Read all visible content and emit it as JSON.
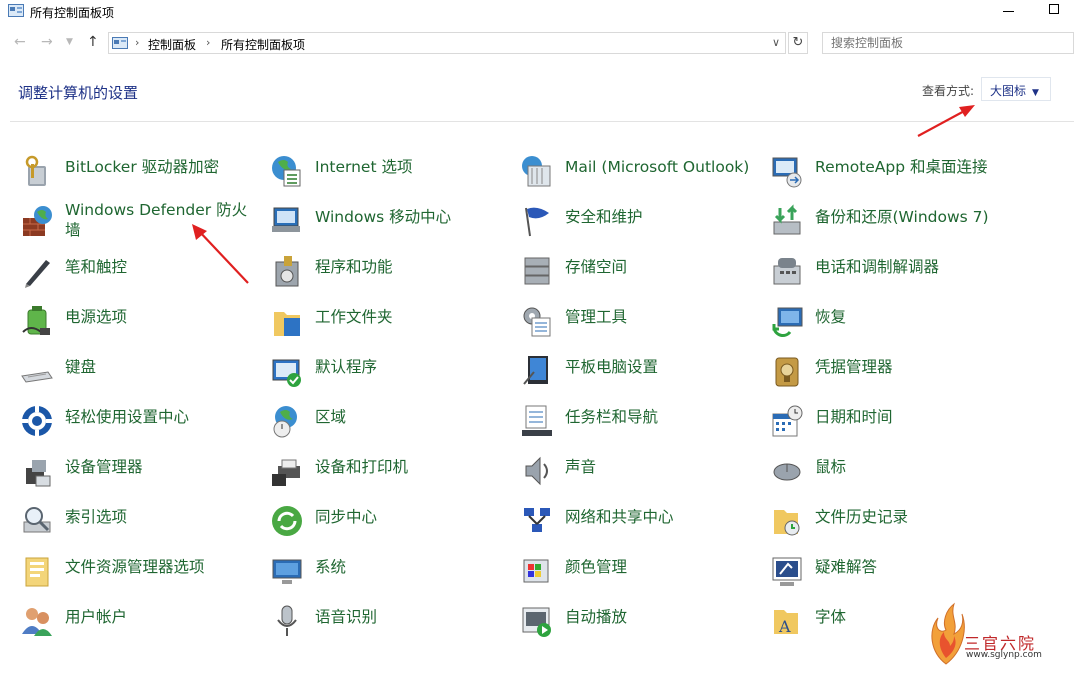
{
  "window": {
    "title": "所有控制面板项",
    "app_icon": "control-panel-icon"
  },
  "address": {
    "breadcrumbs": [
      "控制面板",
      "所有控制面板项"
    ],
    "search_placeholder": "搜索控制面板"
  },
  "header": {
    "title": "调整计算机的设置",
    "view_label": "查看方式:",
    "view_value": "大图标"
  },
  "columns": [
    [
      "BitLocker 驱动器加密",
      "Windows Defender 防火墙",
      "笔和触控",
      "电源选项",
      "键盘",
      "轻松使用设置中心",
      "设备管理器",
      "索引选项",
      "文件资源管理器选项",
      "用户帐户"
    ],
    [
      "Internet 选项",
      "Windows 移动中心",
      "程序和功能",
      "工作文件夹",
      "默认程序",
      "区域",
      "设备和打印机",
      "同步中心",
      "系统",
      "语音识别"
    ],
    [
      "Mail (Microsoft Outlook)",
      "安全和维护",
      "存储空间",
      "管理工具",
      "平板电脑设置",
      "任务栏和导航",
      "声音",
      "网络和共享中心",
      "颜色管理",
      "自动播放"
    ],
    [
      "RemoteApp 和桌面连接",
      "备份和还原(Windows 7)",
      "电话和调制解调器",
      "恢复",
      "凭据管理器",
      "日期和时间",
      "鼠标",
      "文件历史记录",
      "疑难解答",
      "字体"
    ]
  ],
  "icons": [
    [
      "bitlocker-icon",
      "firewall-icon",
      "pen-icon",
      "power-icon",
      "keyboard-icon",
      "ease-of-access-icon",
      "device-manager-icon",
      "indexing-icon",
      "folder-options-icon",
      "user-accounts-icon"
    ],
    [
      "internet-options-icon",
      "mobility-center-icon",
      "programs-icon",
      "work-folders-icon",
      "default-programs-icon",
      "region-icon",
      "devices-printers-icon",
      "sync-center-icon",
      "system-icon",
      "speech-icon"
    ],
    [
      "mail-icon",
      "security-flag-icon",
      "storage-spaces-icon",
      "admin-tools-icon",
      "tablet-icon",
      "taskbar-icon",
      "sound-icon",
      "network-icon",
      "color-management-icon",
      "autoplay-icon"
    ],
    [
      "remoteapp-icon",
      "backup-icon",
      "phone-modem-icon",
      "recovery-icon",
      "credential-icon",
      "date-time-icon",
      "mouse-icon",
      "file-history-icon",
      "troubleshoot-icon",
      "fonts-icon"
    ]
  ],
  "colors": {
    "link": "#1f6631",
    "title": "#1e3287",
    "annotation": "#e02020"
  },
  "watermark": {
    "title": "三官六院",
    "url": "www.sglynp.com"
  }
}
